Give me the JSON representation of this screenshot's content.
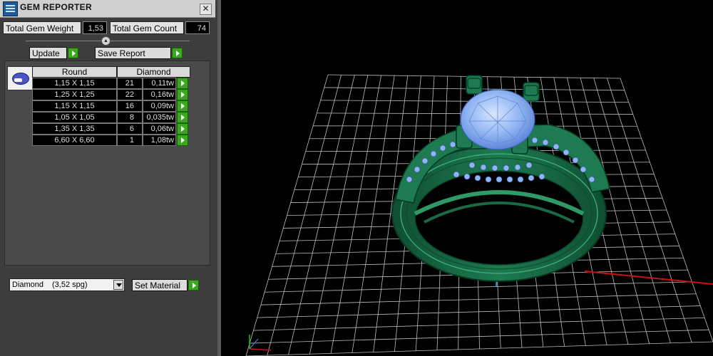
{
  "panel": {
    "title": "GEM REPORTER",
    "close_glyph": "✕",
    "stats": {
      "weight_label": "Total Gem Weight",
      "weight_value": "1,53",
      "count_label": "Total Gem Count",
      "count_value": "74"
    },
    "buttons": {
      "update": "Update",
      "save_report": "Save Report",
      "set_material": "Set Material"
    },
    "table": {
      "header_shape": "Round",
      "header_material": "Diamond",
      "rows": [
        {
          "size": "1,15 X 1,15",
          "count": "21",
          "weight": "0,11tw"
        },
        {
          "size": "1,25 X 1,25",
          "count": "22",
          "weight": "0,16tw"
        },
        {
          "size": "1,15 X 1,15",
          "count": "16",
          "weight": "0,09tw"
        },
        {
          "size": "1,05 X 1,05",
          "count": "8",
          "weight": "0,035tw"
        },
        {
          "size": "1,35 X 1,35",
          "count": "6",
          "weight": "0,06tw"
        },
        {
          "size": "6,60 X 6,60",
          "count": "1",
          "weight": "1,08tw"
        }
      ]
    },
    "material_select": {
      "name": "Diamond",
      "specific_gravity": "(3,52 spg)"
    }
  },
  "icons": {
    "app": "gem-reporter-app-icon",
    "close": "close-icon",
    "collapse": "collapse-up-icon",
    "arrow": "play-arrow-icon",
    "gem_thumbnail": "gem-thumbnail-icon",
    "dropdown": "chevron-down-icon",
    "axis": "axis-gizmo-icon"
  },
  "colors": {
    "panel_bg": "#3d3d3d",
    "accent_green": "#39a81e",
    "ring_metal": "#1e7a50",
    "gem_blue": "#8fb4f2",
    "grid": "#bdbdbd",
    "x_axis": "#d01010",
    "z_axis": "#20a0c0"
  }
}
